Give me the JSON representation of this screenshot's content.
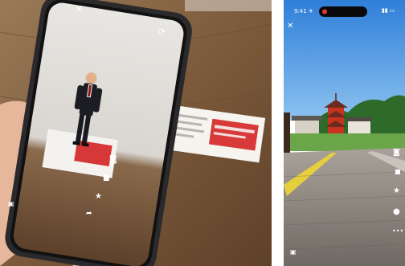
{
  "left_photo": {
    "phone_ui": {
      "close_icon": "x-icon",
      "switch_camera_icon": "camera-switch-icon",
      "side_icons": [
        "camera-icon",
        "video-icon",
        "star-icon",
        "share-icon"
      ]
    }
  },
  "right_screenshot": {
    "status_bar": {
      "time": "9:41 ✈"
    },
    "close_icon": "x-icon",
    "side_icons": [
      "camera-icon",
      "video-icon",
      "star-icon",
      "circle-icon",
      "more-icon"
    ]
  },
  "colors": {
    "sky": "#3a8de0",
    "pagoda_red": "#c8321e",
    "lawn": "#6aa54a",
    "wood_table": "#7a5838"
  }
}
